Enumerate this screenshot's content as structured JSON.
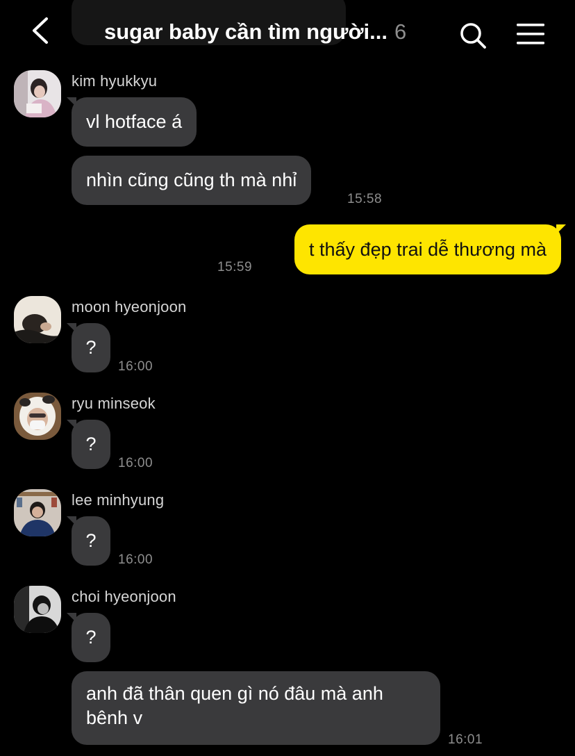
{
  "header": {
    "title": "sugar baby cần tìm người...",
    "member_count": "6",
    "back_icon": "chevron-left-icon",
    "search_icon": "search-icon",
    "menu_icon": "hamburger-menu-icon"
  },
  "colors": {
    "background": "#000000",
    "incoming_bubble": "#3a3a3c",
    "outgoing_bubble": "#fee500",
    "timestamp": "#8e8e8e"
  },
  "messages": [
    {
      "sender": "kim hyukkyu",
      "text": "vl hotface á",
      "time": ""
    },
    {
      "sender": "kim hyukkyu",
      "text": "nhìn cũng cũng th mà nhỉ",
      "time": "15:58"
    },
    {
      "sender": "me",
      "text": "t thấy đẹp trai dễ thương mà",
      "time": "15:59"
    },
    {
      "sender": "moon hyeonjoon",
      "text": "?",
      "time": "16:00"
    },
    {
      "sender": "ryu minseok",
      "text": "?",
      "time": "16:00"
    },
    {
      "sender": "lee minhyung",
      "text": "?",
      "time": "16:00"
    },
    {
      "sender": "choi hyeonjoon",
      "text": "?",
      "time": ""
    },
    {
      "sender": "choi hyeonjoon",
      "text": "anh đã thân quen gì nó đâu mà anh bênh v",
      "time": "16:01"
    }
  ]
}
